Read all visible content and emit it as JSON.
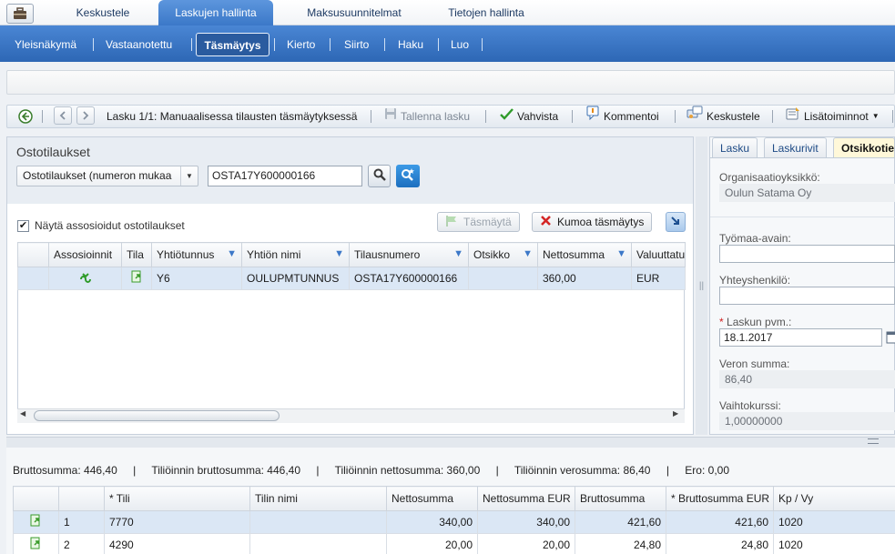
{
  "top_tabs": [
    "Keskustele",
    "Laskujen hallinta",
    "Maksusuunnitelmat",
    "Tietojen hallinta"
  ],
  "sub_nav": [
    "Yleisnäkymä",
    "Vastaanotettu",
    "Täsmäytys",
    "Kierto",
    "Siirto",
    "Haku",
    "Luo"
  ],
  "toolbar": {
    "invoice_label": "Lasku 1/1: Manuaalisessa tilausten täsmäytyksessä",
    "save": "Tallenna lasku",
    "confirm": "Vahvista",
    "comment": "Kommentoi",
    "discuss": "Keskustele",
    "more": "Lisätoiminnot"
  },
  "po_panel": {
    "title": "Ostotilaukset",
    "select_value": "Ostotilaukset (numeron mukaa",
    "search_value": "OSTA17Y600000166",
    "show_assoc_label": "Näytä assosioidut ostotilaukset",
    "match_label": "Täsmäytä",
    "undo_label": "Kumoa täsmäytys",
    "columns": [
      "Assosioinnit",
      "Tila",
      "Yhtiötunnus",
      "Yhtiön nimi",
      "Tilausnumero",
      "Otsikko",
      "Nettosumma",
      "Valuuttatu"
    ],
    "rows": [
      {
        "company_code": "Y6",
        "company_name": "OULUPMTUNNUS",
        "order_number": "OSTA17Y600000166",
        "title": "",
        "net": "360,00",
        "currency": "EUR"
      }
    ]
  },
  "right_panel": {
    "tabs": [
      "Lasku",
      "Laskurivit",
      "Otsikkotie"
    ],
    "org_unit_label": "Organisaatioyksikkö:",
    "org_unit_value": "Oulun Satama Oy",
    "site_key_label": "Työmaa-avain:",
    "contact_label": "Yhteyshenkilö:",
    "invoice_date_label": "Laskun pvm.:",
    "invoice_date_value": "18.1.2017",
    "tax_label": "Veron summa:",
    "tax_value": "86,40",
    "rate_label": "Vaihtokurssi:",
    "rate_value": "1,00000000"
  },
  "totals": {
    "gross_label": "Bruttosumma:",
    "gross": "446,40",
    "acc_gross_label": "Tiliöinnin bruttosumma:",
    "acc_gross": "446,40",
    "acc_net_label": "Tiliöinnin nettosumma:",
    "acc_net": "360,00",
    "acc_tax_label": "Tiliöinnin verosumma:",
    "acc_tax": "86,40",
    "diff_label": "Ero:",
    "diff": "0,00"
  },
  "accounting": {
    "columns": [
      "",
      "",
      "* Tili",
      "Tilin nimi",
      "Nettosumma",
      "Nettosumma EUR",
      "Bruttosumma",
      "* Bruttosumma EUR",
      "Kp / Vy"
    ],
    "rows": [
      {
        "n": "1",
        "account": "7770",
        "name": "",
        "net": "340,00",
        "net_eur": "340,00",
        "gross": "421,60",
        "gross_eur": "421,60",
        "cc": "1020"
      },
      {
        "n": "2",
        "account": "4290",
        "name": "",
        "net": "20,00",
        "net_eur": "20,00",
        "gross": "24,80",
        "gross_eur": "24,80",
        "cc": "1020"
      }
    ]
  }
}
